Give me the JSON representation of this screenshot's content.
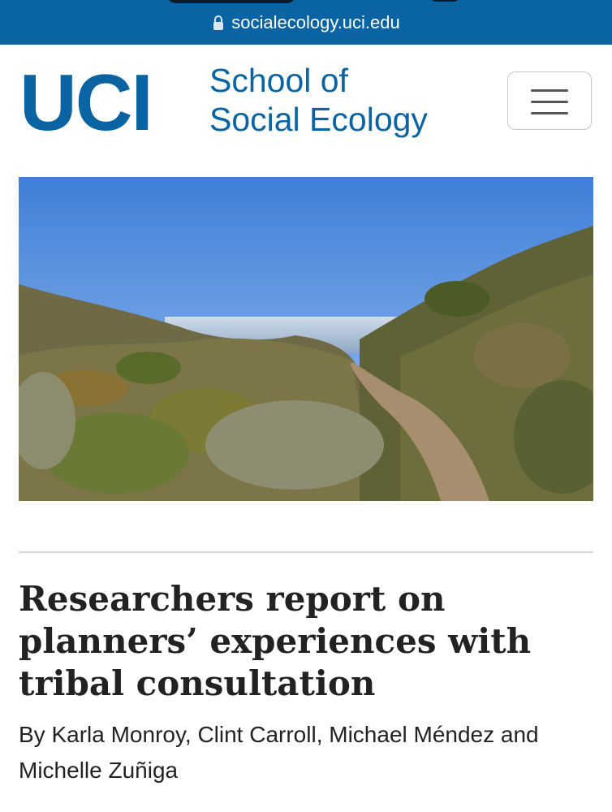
{
  "browser": {
    "url": "socialecology.uci.edu"
  },
  "header": {
    "logo_text": "UCI",
    "school_line1": "School of",
    "school_line2": "Social Ecology",
    "menu_icon": "hamburger-menu-icon"
  },
  "hero": {
    "alt": "Coastal hiking trail through hills leading to the ocean"
  },
  "article": {
    "title": "Researchers report on planners’ experiences with tribal consultation",
    "byline": "By Karla Monroy, Clint Carroll, Michael Méndez and Michelle Zuñiga"
  },
  "colors": {
    "brand_blue": "#0a64a4",
    "text": "#222222",
    "divider": "#d6d6d6"
  }
}
